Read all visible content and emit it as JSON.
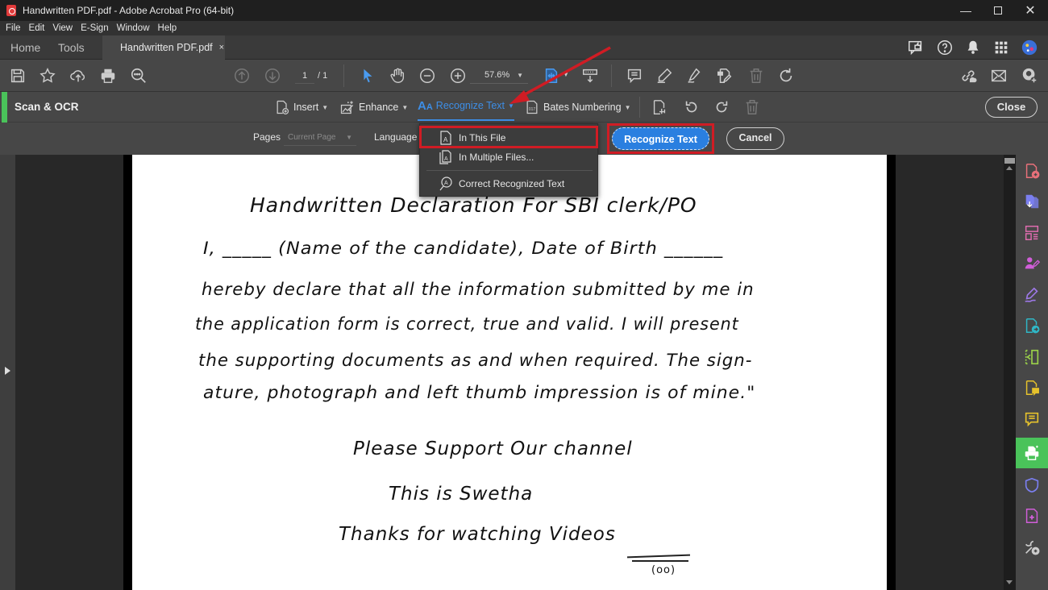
{
  "window": {
    "title": "Handwritten PDF.pdf - Adobe Acrobat Pro (64-bit)",
    "controls": [
      "minimize",
      "maximize",
      "close"
    ]
  },
  "menu": [
    "File",
    "Edit",
    "View",
    "E-Sign",
    "Window",
    "Help"
  ],
  "tabs": {
    "home": "Home",
    "tools": "Tools",
    "document": "Handwritten PDF.pdf",
    "close_glyph": "×"
  },
  "toolbar": {
    "page_current": "1",
    "page_total": "/ 1",
    "zoom": "57.6%"
  },
  "ocr_bar": {
    "title": "Scan & OCR",
    "tools": [
      {
        "label": "Insert",
        "icon": "insert-page-icon"
      },
      {
        "label": "Enhance",
        "icon": "enhance-image-icon"
      },
      {
        "label": "Recognize Text",
        "icon": "recognize-text-icon",
        "active": true
      },
      {
        "label": "Bates Numbering",
        "icon": "bates-numbering-icon"
      }
    ],
    "close_label": "Close"
  },
  "options_bar": {
    "pages_label": "Pages",
    "pages_value": "Current Page",
    "language_label": "Language",
    "recognize_button": "Recognize Text",
    "cancel_button": "Cancel"
  },
  "dropdown": {
    "items": [
      {
        "label": "In This File",
        "icon": "file-text-icon",
        "highlighted": true
      },
      {
        "label": "In Multiple Files...",
        "icon": "multiple-files-icon"
      },
      {
        "label": "Correct Recognized Text",
        "icon": "correct-text-icon"
      }
    ]
  },
  "document": {
    "lines": [
      "Handwritten Declaration For SBI clerk/PO",
      "I, _____ (Name of the candidate), Date of Birth ______",
      "hereby declare that all the information submitted by me in",
      "the application form is correct, true and valid. I will present",
      "the supporting documents as and when required. The sign-",
      "ature, photograph and left thumb impression is of mine.\"",
      "Please Support Our channel",
      "This is Swetha",
      "Thanks for watching Videos",
      "(oo)"
    ]
  },
  "colors": {
    "accent_green": "#4ac35a",
    "accent_blue": "#2a7fe0",
    "annotation_red": "#d01c24"
  }
}
